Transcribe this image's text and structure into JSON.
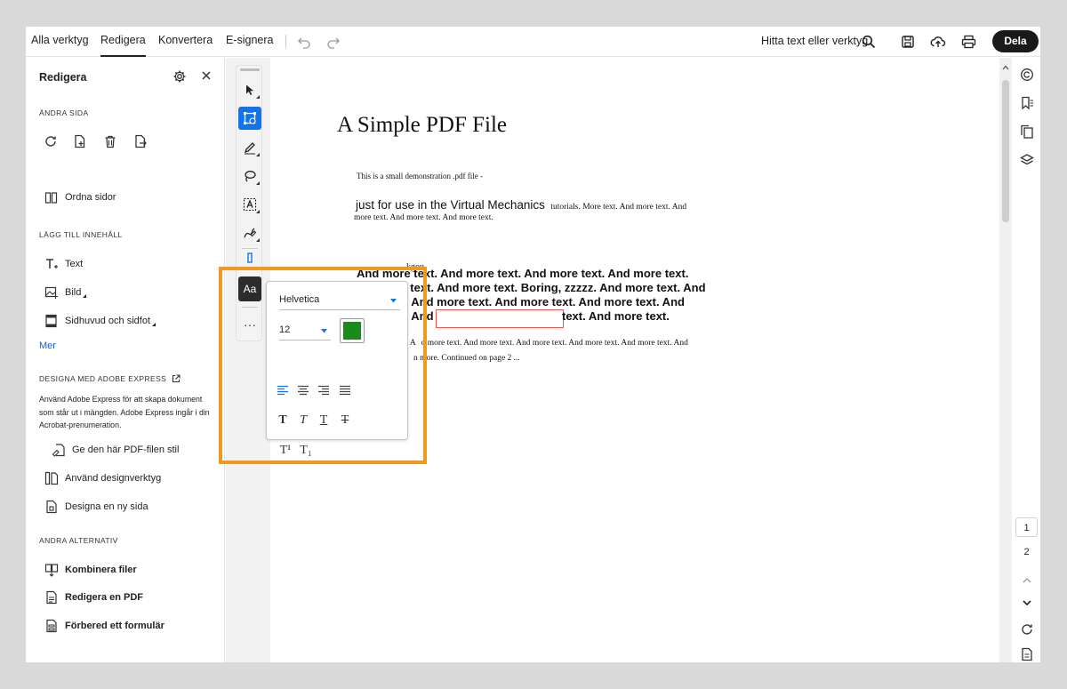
{
  "topbar": {
    "tabs": [
      "Alla verktyg",
      "Redigera",
      "Konvertera",
      "E-signera"
    ],
    "active_tab": "Redigera",
    "search_text": "Hitta text eller verktyg",
    "share_label": "Dela",
    "icons": [
      "undo-icon",
      "redo-icon",
      "search-icon",
      "save-icon",
      "cloud-upload-icon",
      "print-icon"
    ]
  },
  "left_panel": {
    "title": "Redigera",
    "sections": {
      "change_page": {
        "heading": "ÄNDRA SIDA",
        "icons": [
          "rotate-icon",
          "insert-page-icon",
          "delete-page-icon",
          "extract-page-icon"
        ],
        "organize_label": "Ordna sidor"
      },
      "add_content": {
        "heading": "LÄGG TILL INNEHÅLL",
        "items": [
          "Text",
          "Bild",
          "Sidhuvud och sidfot"
        ],
        "more_label": "Mer"
      },
      "express": {
        "heading": "DESIGNA MED ADOBE EXPRESS",
        "description": "Använd Adobe Express för att skapa dokument som står ut i mängden. Adobe Express ingår i din Acrobat-prenumeration.",
        "items": [
          "Ge den här PDF-filen stil",
          "Använd designverktyg",
          "Designa en ny sida"
        ]
      },
      "other": {
        "heading": "ANDRA ALTERNATIV",
        "items": [
          "Kombinera filer",
          "Redigera en PDF",
          "Förbered ett formulär"
        ]
      }
    }
  },
  "toolbar": {
    "text_format_label": "Aa",
    "more_label": "···"
  },
  "format_popover": {
    "font": "Helvetica",
    "size": "12",
    "color": "#1a8a1a",
    "alignment": "left",
    "superscript_label": "T¹",
    "subscript_label": "T₁"
  },
  "document": {
    "title": "A Simple PDF File",
    "line1": "This is a small demonstration .pdf file -",
    "line2_sans": "just for use in the Virtual Mechanics",
    "line2_serif": "tutorials. More text. And more  text. And",
    "line3": "more text. And more text. And more text.",
    "overlay_word": "kgou",
    "bold_lines": [
      "And more text. And more text. And more text. And more text.",
      "And more  text. And more text. Boring, zzzzz. And more text. And",
      "more text. And  more text. And more text. And more text. And",
      "text. And more text."
    ],
    "bold_line4_prefix": "more text. And",
    "para3_line1_a": "t. A",
    "para3_line1_b": "d more text. And more text. And more text. And more  text. And more text. And",
    "para3_line2_a": "t",
    "para3_line2_b": "n more. Continued on page 2 ..."
  },
  "page_nav": {
    "pages": [
      "1",
      "2"
    ],
    "current": "1"
  },
  "colors": {
    "accent": "#1473e6",
    "highlight": "#f0981f",
    "text_color_swatch": "#1a8a1a",
    "edit_box_border": "#e05a4f"
  }
}
